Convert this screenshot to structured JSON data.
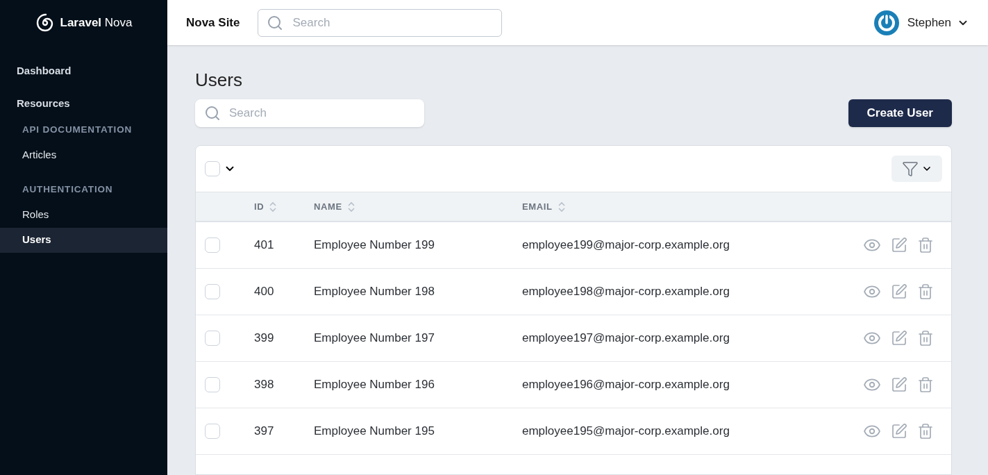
{
  "brand": {
    "name_bold": "Laravel",
    "name_light": "Nova"
  },
  "sidebar": {
    "sections": [
      {
        "title": "Dashboard"
      },
      {
        "title": "Resources",
        "groups": [
          {
            "title": "API DOCUMENTATION",
            "items": [
              {
                "label": "Articles",
                "selected": false
              }
            ]
          },
          {
            "title": "AUTHENTICATION",
            "items": [
              {
                "label": "Roles",
                "selected": false
              },
              {
                "label": "Users",
                "selected": true
              }
            ]
          }
        ]
      }
    ]
  },
  "header": {
    "site": "Nova Site",
    "search": {
      "placeholder": "Search"
    },
    "user": "Stephen"
  },
  "page": {
    "title": "Users",
    "search": {
      "placeholder": "Search"
    },
    "create_button": "Create User"
  },
  "table": {
    "select_all": {
      "checked": false
    },
    "columns": [
      "ID",
      "NAME",
      "EMAIL"
    ],
    "rows": [
      {
        "id": "401",
        "name": "Employee Number 199",
        "email": "employee199@major-corp.example.org",
        "checked": false
      },
      {
        "id": "400",
        "name": "Employee Number 198",
        "email": "employee198@major-corp.example.org",
        "checked": false
      },
      {
        "id": "399",
        "name": "Employee Number 197",
        "email": "employee197@major-corp.example.org",
        "checked": false
      },
      {
        "id": "398",
        "name": "Employee Number 196",
        "email": "employee196@major-corp.example.org",
        "checked": false
      },
      {
        "id": "397",
        "name": "Employee Number 195",
        "email": "employee195@major-corp.example.org",
        "checked": false
      }
    ]
  }
}
